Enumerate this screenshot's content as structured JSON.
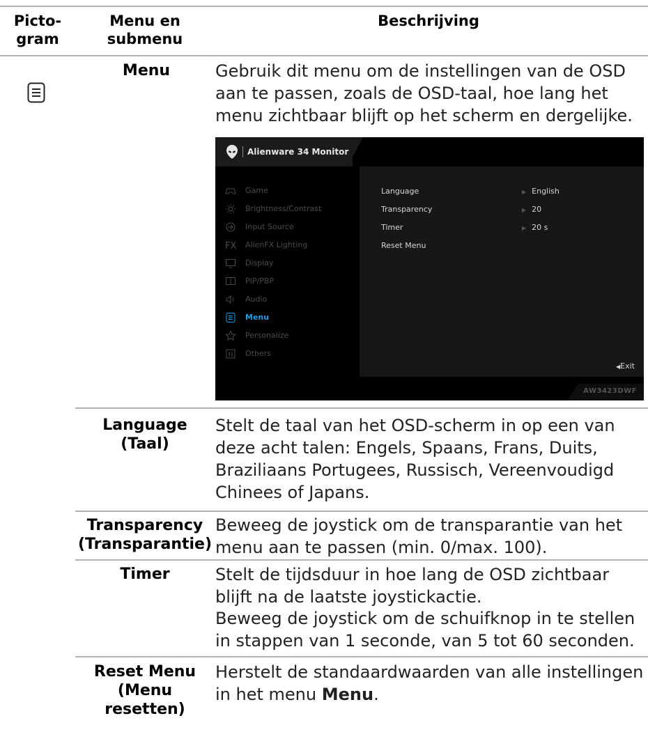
{
  "table": {
    "header": {
      "icon_col": "Picto-\ngram",
      "menu_col": "Menu en\nsubmenu",
      "desc_col": "Beschrijving"
    },
    "icon": "menu-icon",
    "menu_label": "Menu",
    "menu_desc": "Gebruik dit menu om de instellingen van de OSD aan te passen, zoals de OSD-taal, hoe lang het menu zichtbaar blijft op het scherm en dergelijke.",
    "rows": [
      {
        "label": "Language\n(Taal)",
        "desc": "Stelt de taal van het OSD-scherm in op een van deze acht talen: Engels, Spaans, Frans, Duits, Braziliaans Portugees, Russisch, Vereenvoudigd Chinees of Japans."
      },
      {
        "label": "Transparency\n(Transparantie)",
        "desc": "Beweeg de joystick om de transparantie van het menu aan te passen (min. 0/max. 100)."
      },
      {
        "label": "Timer",
        "desc": "Stelt de tijdsduur in hoe lang de OSD zichtbaar blijft na de laatste joystickactie.",
        "desc2": "Beweeg de joystick om de schuifknop in te stellen in stappen van 1 seconde, van 5 tot 60 seconden."
      },
      {
        "label": "Reset Menu\n(Menu\nresetten)",
        "desc_prefix": "Herstelt de standaardwaarden van alle instellingen in het menu ",
        "desc_bold": "Menu",
        "desc_suffix": "."
      }
    ]
  },
  "osd": {
    "title": "Alienware 34 Monitor",
    "model": "AW3423DWF",
    "active_color": "#1e9be6",
    "nav": [
      {
        "label": "Game",
        "icon": "gamepad-icon"
      },
      {
        "label": "Brightness/Contrast",
        "icon": "brightness-icon"
      },
      {
        "label": "Input Source",
        "icon": "input-source-icon"
      },
      {
        "label": "AlienFX Lighting",
        "icon": "fx-icon"
      },
      {
        "label": "Display",
        "icon": "display-icon"
      },
      {
        "label": "PIP/PBP",
        "icon": "pip-icon"
      },
      {
        "label": "Audio",
        "icon": "speaker-icon"
      },
      {
        "label": "Menu",
        "icon": "menu-icon",
        "active": true
      },
      {
        "label": "Personalize",
        "icon": "star-icon"
      },
      {
        "label": "Others",
        "icon": "others-icon"
      }
    ],
    "options": [
      {
        "label": "Language",
        "value": "English"
      },
      {
        "label": "Transparency",
        "value": "20"
      },
      {
        "label": "Timer",
        "value": "20 s"
      },
      {
        "label": "Reset Menu",
        "value": ""
      }
    ],
    "exit_label": "Exit"
  }
}
